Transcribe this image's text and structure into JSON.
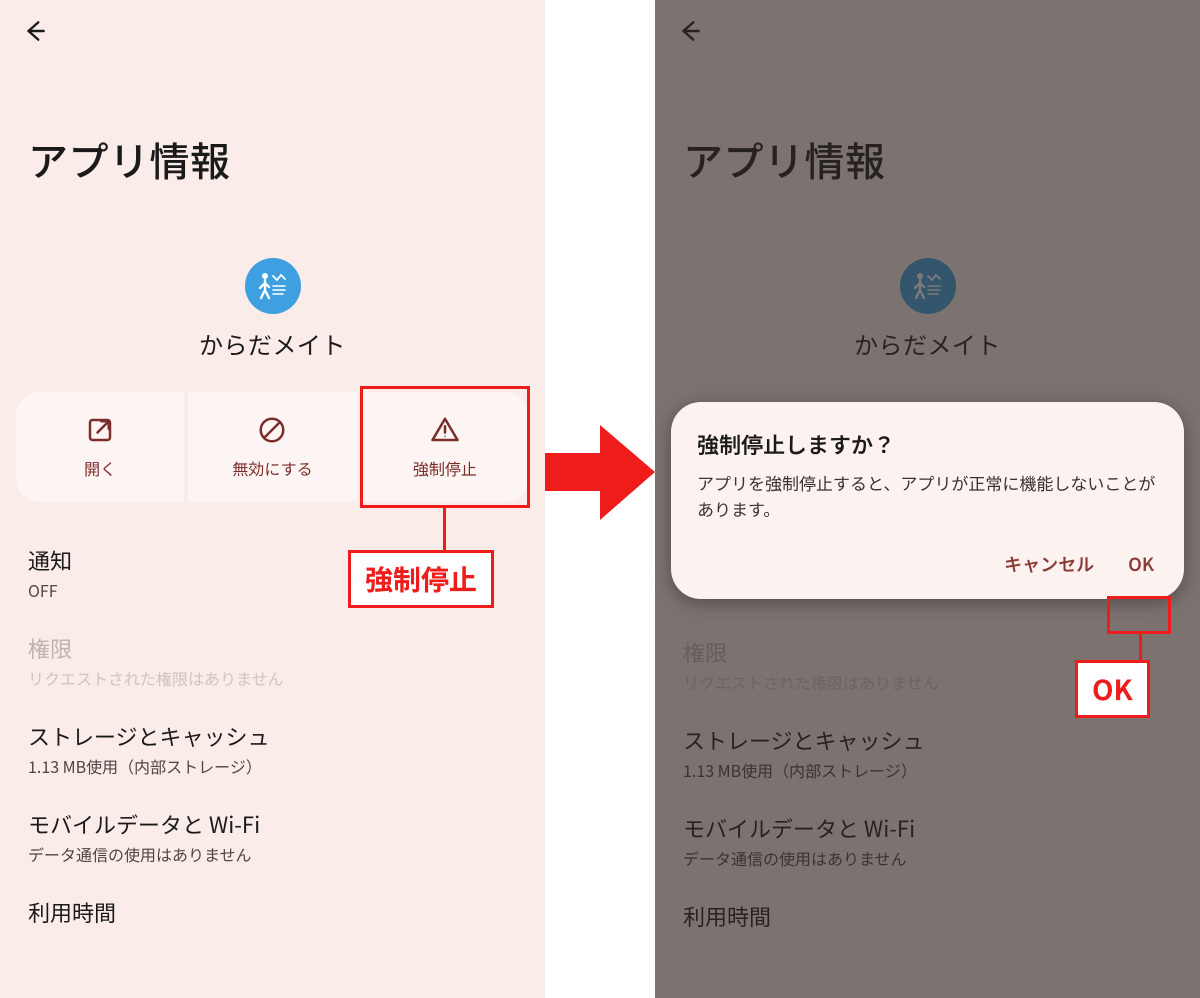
{
  "colors": {
    "highlight": "#ef1c1c",
    "action_text": "#7a2e2b",
    "app_icon_bg": "#3ea0e0"
  },
  "left": {
    "page_title": "アプリ情報",
    "app_name": "からだメイト",
    "actions": {
      "open": "開く",
      "disable": "無効にする",
      "force_stop": "強制停止"
    },
    "callout_force_stop": "強制停止",
    "list": {
      "notifications": {
        "title": "通知",
        "value": "OFF"
      },
      "permissions": {
        "title": "権限",
        "value": "リクエストされた権限はありません"
      },
      "storage": {
        "title": "ストレージとキャッシュ",
        "value": "1.13 MB使用（内部ストレージ）"
      },
      "mobiledata": {
        "title": "モバイルデータと Wi-Fi",
        "value": "データ通信の使用はありません"
      },
      "screentime": {
        "title": "利用時間"
      }
    }
  },
  "right": {
    "page_title": "アプリ情報",
    "app_name": "からだメイト",
    "dialog": {
      "title": "強制停止しますか？",
      "body": "アプリを強制停止すると、アプリが正常に機能しないことがあります。",
      "cancel": "キャンセル",
      "ok": "OK"
    },
    "callout_ok": "OK",
    "list": {
      "permissions": {
        "title": "権限",
        "value": "リクエストされた権限はありません"
      },
      "storage": {
        "title": "ストレージとキャッシュ",
        "value": "1.13 MB使用（内部ストレージ）"
      },
      "mobiledata": {
        "title": "モバイルデータと Wi-Fi",
        "value": "データ通信の使用はありません"
      },
      "screentime": {
        "title": "利用時間"
      }
    }
  }
}
